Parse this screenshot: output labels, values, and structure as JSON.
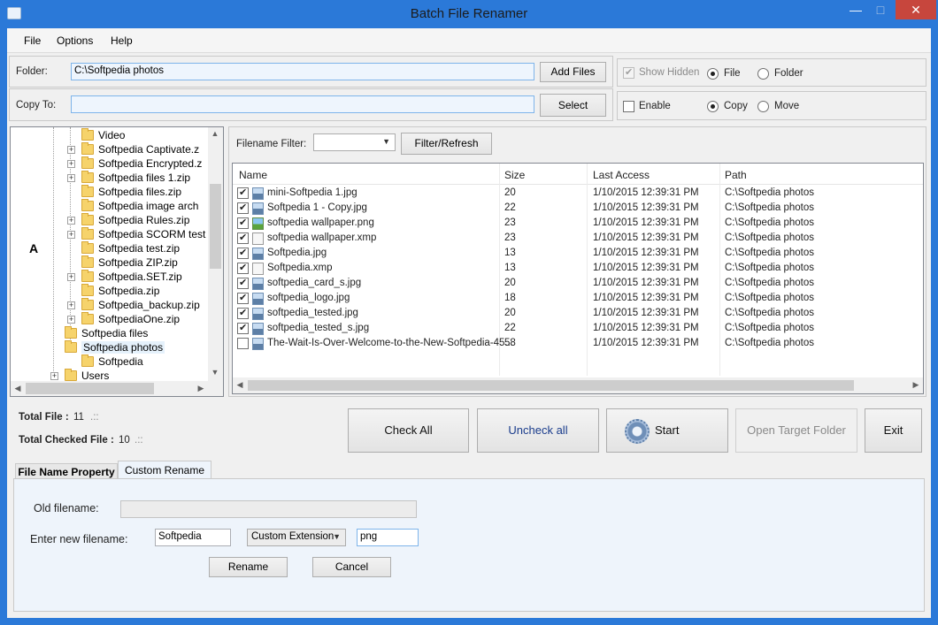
{
  "window": {
    "title": "Batch File Renamer"
  },
  "menu": [
    "File",
    "Options",
    "Help"
  ],
  "folder": {
    "label": "Folder:",
    "value": "C:\\Softpedia photos",
    "button": "Add Files"
  },
  "copy_to": {
    "label": "Copy To:",
    "value": "",
    "button": "Select"
  },
  "options": {
    "show_hidden": "Show Hidden",
    "file": "File",
    "folder": "Folder",
    "enable": "Enable",
    "copy": "Copy",
    "move": "Move"
  },
  "tree": {
    "letter": "A",
    "items": [
      {
        "label": "Video",
        "expand": false
      },
      {
        "label": "Softpedia Captivate.z",
        "expand": true
      },
      {
        "label": "Softpedia Encrypted.z",
        "expand": true
      },
      {
        "label": "Softpedia files 1.zip",
        "expand": true
      },
      {
        "label": "Softpedia files.zip",
        "expand": false
      },
      {
        "label": "Softpedia image arch",
        "expand": false
      },
      {
        "label": "Softpedia Rules.zip",
        "expand": true
      },
      {
        "label": "Softpedia SCORM test",
        "expand": true
      },
      {
        "label": "Softpedia test.zip",
        "expand": false
      },
      {
        "label": "Softpedia ZIP.zip",
        "expand": false
      },
      {
        "label": "Softpedia.SET.zip",
        "expand": true
      },
      {
        "label": "Softpedia.zip",
        "expand": false
      },
      {
        "label": "Softpedia_backup.zip",
        "expand": true
      },
      {
        "label": "SoftpediaOne.zip",
        "expand": true
      },
      {
        "label": "Softpedia files",
        "expand": false
      },
      {
        "label": "Softpedia photos",
        "expand": false
      },
      {
        "label": "Softpedia",
        "expand": false
      },
      {
        "label": "Users",
        "expand": true
      }
    ]
  },
  "filter": {
    "label": "Filename Filter:",
    "button": "Filter/Refresh"
  },
  "grid": {
    "headers": [
      "Name",
      "Size",
      "Last Access",
      "Path"
    ],
    "rows": [
      {
        "checked": true,
        "icon": "image-file-icon",
        "name": "mini-Softpedia 1.jpg",
        "size": "20",
        "access": "1/10/2015 12:39:31 PM",
        "path": "C:\\Softpedia photos"
      },
      {
        "checked": true,
        "icon": "image-file-icon",
        "name": "Softpedia 1 - Copy.jpg",
        "size": "22",
        "access": "1/10/2015 12:39:31 PM",
        "path": "C:\\Softpedia photos"
      },
      {
        "checked": true,
        "icon": "png-file-icon",
        "name": "softpedia wallpaper.png",
        "size": "23",
        "access": "1/10/2015 12:39:31 PM",
        "path": "C:\\Softpedia photos"
      },
      {
        "checked": true,
        "icon": "document-file-icon",
        "name": "softpedia wallpaper.xmp",
        "size": "23",
        "access": "1/10/2015 12:39:31 PM",
        "path": "C:\\Softpedia photos"
      },
      {
        "checked": true,
        "icon": "image-file-icon",
        "name": "Softpedia.jpg",
        "size": "13",
        "access": "1/10/2015 12:39:31 PM",
        "path": "C:\\Softpedia photos"
      },
      {
        "checked": true,
        "icon": "document-file-icon",
        "name": "Softpedia.xmp",
        "size": "13",
        "access": "1/10/2015 12:39:31 PM",
        "path": "C:\\Softpedia photos"
      },
      {
        "checked": true,
        "icon": "image-file-icon",
        "name": "softpedia_card_s.jpg",
        "size": "20",
        "access": "1/10/2015 12:39:31 PM",
        "path": "C:\\Softpedia photos"
      },
      {
        "checked": true,
        "icon": "image-file-icon",
        "name": "softpedia_logo.jpg",
        "size": "18",
        "access": "1/10/2015 12:39:31 PM",
        "path": "C:\\Softpedia photos"
      },
      {
        "checked": true,
        "icon": "image-file-icon",
        "name": "softpedia_tested.jpg",
        "size": "20",
        "access": "1/10/2015 12:39:31 PM",
        "path": "C:\\Softpedia photos"
      },
      {
        "checked": true,
        "icon": "image-file-icon",
        "name": "softpedia_tested_s.jpg",
        "size": "22",
        "access": "1/10/2015 12:39:31 PM",
        "path": "C:\\Softpedia photos"
      },
      {
        "checked": false,
        "icon": "image-file-icon",
        "name": "The-Wait-Is-Over-Welcome-to-the-New-Softpedia-45...",
        "size": "58",
        "access": "1/10/2015 12:39:31 PM",
        "path": "C:\\Softpedia photos"
      }
    ]
  },
  "stats": {
    "total_file_label": "Total File :",
    "total_file": "11",
    "total_checked_label": "Total Checked File :",
    "total_checked": "10"
  },
  "actions": {
    "check_all": "Check All",
    "uncheck_all": "Uncheck all",
    "start": "Start",
    "open_target": "Open Target Folder",
    "exit": "Exit"
  },
  "tabs": {
    "file_name_property": "File Name Property",
    "custom_rename": "Custom Rename"
  },
  "rename": {
    "old_label": "Old filename:",
    "old_value": "",
    "new_label": "Enter new filename:",
    "new_value": "Softpedia",
    "mode": "Custom Extension",
    "extension": "png",
    "rename_button": "Rename",
    "cancel_button": "Cancel"
  },
  "colors": {
    "titlebar": "#2b79d8",
    "close": "#c7463d",
    "uncheck_text": "#1a3c8c"
  }
}
